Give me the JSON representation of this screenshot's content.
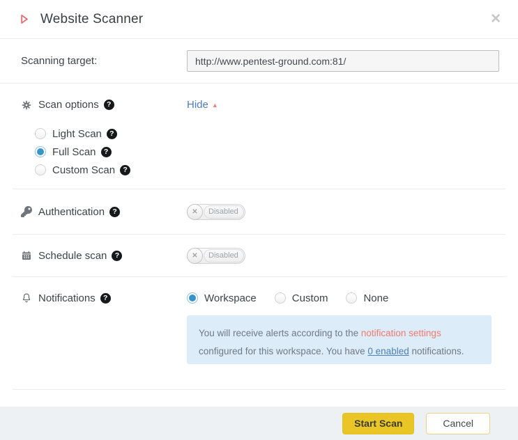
{
  "header": {
    "title": "Website Scanner"
  },
  "icons": {
    "close": "✕",
    "help": "?",
    "caret_up": "▲",
    "toggle_x": "✕"
  },
  "scanning_target": {
    "label": "Scanning target:",
    "value": "http://www.pentest-ground.com:81/"
  },
  "scan_options": {
    "label": "Scan options",
    "hide_label": "Hide",
    "options": [
      {
        "label": "Light Scan",
        "selected": false
      },
      {
        "label": "Full Scan",
        "selected": true
      },
      {
        "label": "Custom Scan",
        "selected": false
      }
    ]
  },
  "authentication": {
    "label": "Authentication",
    "status": "Disabled"
  },
  "schedule": {
    "label": "Schedule scan",
    "status": "Disabled"
  },
  "notifications": {
    "label": "Notifications",
    "options": [
      {
        "label": "Workspace",
        "selected": true
      },
      {
        "label": "Custom",
        "selected": false
      },
      {
        "label": "None",
        "selected": false
      }
    ],
    "info": {
      "text_before": "You will receive alerts according to the ",
      "link1": "notification settings",
      "text_middle": " configured for this workspace. You have ",
      "link2": "0 enabled",
      "text_after": " notifications."
    }
  },
  "footer": {
    "start_label": "Start Scan",
    "cancel_label": "Cancel"
  },
  "colors": {
    "accent_yellow": "#e9c626",
    "radio_blue": "#3793c9",
    "salmon": "#ed6f68",
    "link_blue": "#4d7fbb",
    "info_bg": "#dcecf8",
    "footer_bg": "#eef1f4"
  }
}
